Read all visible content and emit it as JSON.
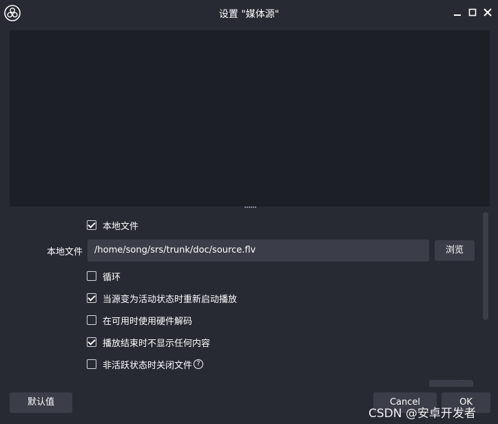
{
  "window": {
    "title": "设置 \"媒体源\""
  },
  "options": {
    "local_file": {
      "label": "本地文件",
      "checked": true
    },
    "loop": {
      "label": "循环",
      "checked": false
    },
    "restart_on_active": {
      "label": "当源变为活动状态时重新启动播放",
      "checked": true
    },
    "hw_decode": {
      "label": "在可用时使用硬件解码",
      "checked": false
    },
    "hide_on_end": {
      "label": "播放结束时不显示任何内容",
      "checked": true
    },
    "close_when_inactive": {
      "label": "非活跃状态时关闭文件",
      "checked": false
    }
  },
  "file": {
    "label": "本地文件",
    "value": "/home/song/srs/trunk/doc/source.flv",
    "browse_label": "浏览"
  },
  "footer": {
    "defaults_label": "默认值",
    "cancel_label": "Cancel",
    "ok_label": "OK"
  },
  "watermark": "CSDN @安卓开发者",
  "colors": {
    "background": "#272a33",
    "preview": "#1d1f26",
    "control": "#3b3e48"
  }
}
